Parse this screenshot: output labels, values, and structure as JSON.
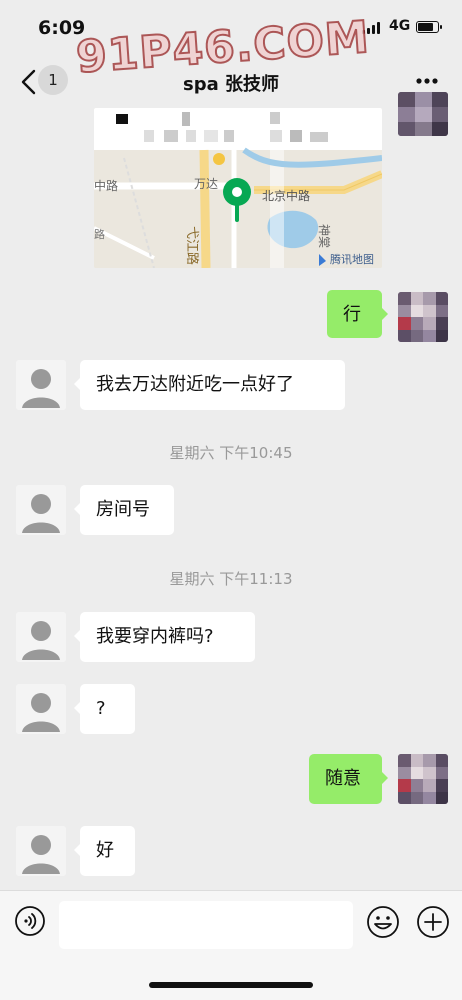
{
  "status_bar": {
    "time": "6:09",
    "network": "4G"
  },
  "header": {
    "unread_count": "1",
    "title": "spa 张技师"
  },
  "watermark": {
    "text": "91P46.COM"
  },
  "map": {
    "labels": {
      "road_west": "中路",
      "wanda": "万达",
      "beijing_road": "北京中路",
      "yijiang_road": "弋江路",
      "shenchao": "神棠",
      "provider": "腾讯地图",
      "left_edge": "路"
    }
  },
  "messages": [
    {
      "side": "out",
      "text": "行"
    },
    {
      "side": "in",
      "text": "我去万达附近吃一点好了"
    },
    {
      "type": "time",
      "text": "星期六 下午10:45"
    },
    {
      "side": "in",
      "text": "房间号"
    },
    {
      "type": "time",
      "text": "星期六 下午11:13"
    },
    {
      "side": "in",
      "text": "我要穿内裤吗?"
    },
    {
      "side": "in",
      "text": "?"
    },
    {
      "side": "out",
      "text": "随意"
    },
    {
      "side": "in",
      "text": "好"
    }
  ],
  "input_bar": {
    "value": ""
  },
  "colors": {
    "background": "#ededed",
    "outgoing_bubble": "#95ec69",
    "incoming_bubble": "#ffffff",
    "map_pin": "#07a853"
  }
}
